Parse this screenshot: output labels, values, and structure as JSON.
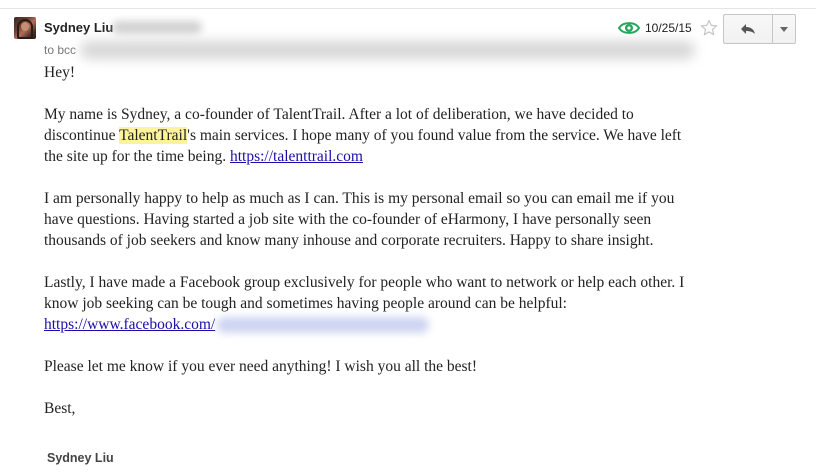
{
  "header": {
    "sender_name": "Sydney Liu",
    "to_prefix": "to bcc",
    "date": "10/25/15",
    "icons": {
      "read_receipt": "eye-icon",
      "star": "star-icon",
      "reply": "reply-arrow-icon",
      "more": "chevron-down-icon"
    },
    "colors": {
      "eye": "#26a65b",
      "link": "#1a0dab",
      "highlight": "#fdf39c"
    }
  },
  "body": {
    "greeting": "Hey!",
    "p1_line1": "My name is Sydney, a co-founder of TalentTrail. After a lot of deliberation, we have decided to",
    "p1_line2_before": "discontinue ",
    "p1_highlight": "TalentTrail",
    "p1_line2_after": "'s main services. I hope many of you found value from the service. We have left",
    "p1_line3": "the site up for the time being. ",
    "p1_link": "https://talenttrail.com",
    "p2_line1": "I am personally happy to help as much as I can. This is my personal email so you can email me if you",
    "p2_line2": "have questions. Having started a job site with the co-founder of eHarmony, I have personally seen",
    "p2_line3": "thousands of job seekers and know many inhouse and corporate recruiters. Happy to share insight.",
    "p3_line1": "Lastly, I have made a Facebook group exclusively for people who want to network or help each other. I",
    "p3_line2": "know job seeking can be tough and sometimes having people around can be helpful:",
    "p3_link": "https://www.facebook.com/",
    "p4": "Please let me know if you ever need anything! I wish you all the best!",
    "closing": "Best,"
  },
  "signature": "Sydney Liu"
}
